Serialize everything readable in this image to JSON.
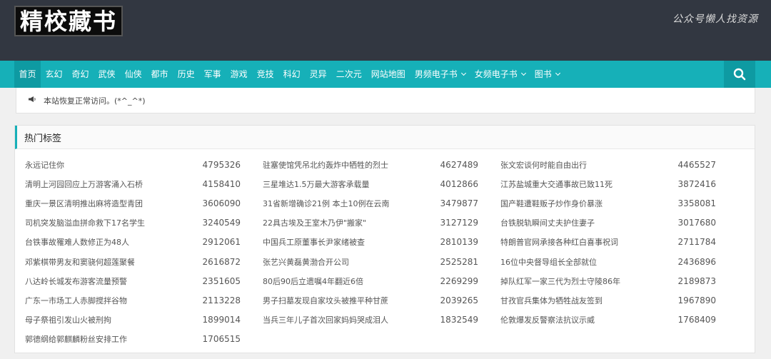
{
  "header": {
    "logo_text": "精校藏书",
    "slogan": "公众号懒人找资源"
  },
  "nav": {
    "items": [
      {
        "label": "首页",
        "active": true,
        "dropdown": false
      },
      {
        "label": "玄幻",
        "dropdown": false
      },
      {
        "label": "奇幻",
        "dropdown": false
      },
      {
        "label": "武侠",
        "dropdown": false
      },
      {
        "label": "仙侠",
        "dropdown": false
      },
      {
        "label": "都市",
        "dropdown": false
      },
      {
        "label": "历史",
        "dropdown": false
      },
      {
        "label": "军事",
        "dropdown": false
      },
      {
        "label": "游戏",
        "dropdown": false
      },
      {
        "label": "竞技",
        "dropdown": false
      },
      {
        "label": "科幻",
        "dropdown": false
      },
      {
        "label": "灵异",
        "dropdown": false
      },
      {
        "label": "二次元",
        "dropdown": false
      },
      {
        "label": "网站地图",
        "dropdown": false
      },
      {
        "label": "男频电子书",
        "dropdown": true
      },
      {
        "label": "女频电子书",
        "dropdown": true
      },
      {
        "label": "图书",
        "dropdown": true
      }
    ],
    "search_icon": "search-icon"
  },
  "notice": {
    "icon": "speaker-icon",
    "text": "本站恢复正常访问。(*^_^*)"
  },
  "hot_tags": {
    "title": "热门标签",
    "tags": [
      {
        "title": "永远记住你",
        "count": "4795326"
      },
      {
        "title": "驻塞使馆凭吊北约轰炸中牺牲的烈士",
        "count": "4627489"
      },
      {
        "title": "张文宏谈何时能自由出行",
        "count": "4465527"
      },
      {
        "title": "清明上河园回应上万游客涌入石桥",
        "count": "4158410"
      },
      {
        "title": "三星堆达1.5万最大游客承载量",
        "count": "4012866"
      },
      {
        "title": "江苏盐城重大交通事故已致11死",
        "count": "3872416"
      },
      {
        "title": "重庆一景区清明推出麻将造型青团",
        "count": "3606090"
      },
      {
        "title": "31省新增确诊21例 本土10例在云南",
        "count": "3479877"
      },
      {
        "title": "国产鞋遭鞋贩子炒作身价暴涨",
        "count": "3358081"
      },
      {
        "title": "司机突发脑溢血拼命救下17名学生",
        "count": "3240549"
      },
      {
        "title": "22具古埃及王室木乃伊\"搬家\"",
        "count": "3127129"
      },
      {
        "title": "台铁脱轨瞬间丈夫护住妻子",
        "count": "3017680"
      },
      {
        "title": "台铁事故罹难人数修正为48人",
        "count": "2912061"
      },
      {
        "title": "中国兵工原董事长尹家绪被查",
        "count": "2810139"
      },
      {
        "title": "特朗普官网承接各种红白喜事祝词",
        "count": "2711784"
      },
      {
        "title": "邓紫棋带男友和窦骁何超莲聚餐",
        "count": "2616872"
      },
      {
        "title": "张艺兴黄磊黄渤合开公司",
        "count": "2525281"
      },
      {
        "title": "16位中央督导组长全部就位",
        "count": "2436896"
      },
      {
        "title": "八达岭长城发布游客流量预警",
        "count": "2351605"
      },
      {
        "title": "80后90后立遗嘱4年翻近6倍",
        "count": "2269299"
      },
      {
        "title": "掉队红军一家三代为烈士守陵86年",
        "count": "2189873"
      },
      {
        "title": "广东一市场工人赤脚搅拌谷物",
        "count": "2113228"
      },
      {
        "title": "男子扫墓发现自家坟头被推平种甘蔗",
        "count": "2039265"
      },
      {
        "title": "甘孜官兵集体为牺牲战友签到",
        "count": "1967890"
      },
      {
        "title": "母子祭祖引发山火被刑拘",
        "count": "1899014"
      },
      {
        "title": "当兵三年儿子首次回家妈妈哭成泪人",
        "count": "1832549"
      },
      {
        "title": "伦敦爆发反警察法抗议示威",
        "count": "1768409"
      },
      {
        "title": "郭德纲给郭麒麟粉丝安排工作",
        "count": "1706515"
      }
    ]
  }
}
